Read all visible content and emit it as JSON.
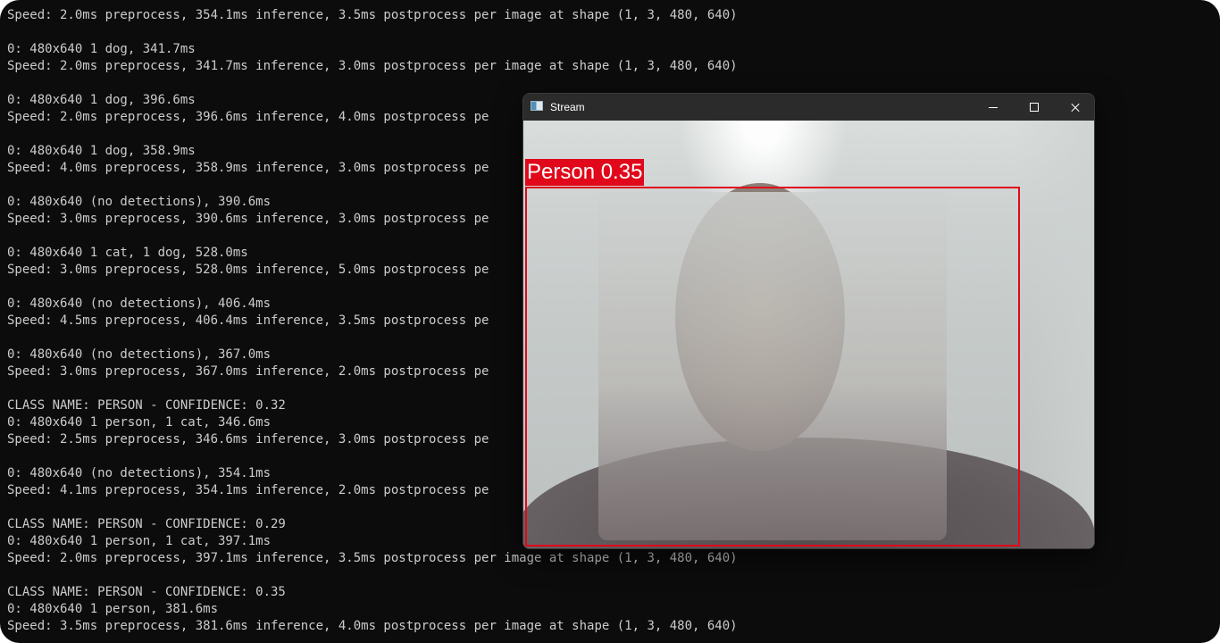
{
  "terminal": {
    "lines": [
      "Speed: 2.0ms preprocess, 354.1ms inference, 3.5ms postprocess per image at shape (1, 3, 480, 640)",
      "",
      "0: 480x640 1 dog, 341.7ms",
      "Speed: 2.0ms preprocess, 341.7ms inference, 3.0ms postprocess per image at shape (1, 3, 480, 640)",
      "",
      "0: 480x640 1 dog, 396.6ms",
      "Speed: 2.0ms preprocess, 396.6ms inference, 4.0ms postprocess pe",
      "",
      "0: 480x640 1 dog, 358.9ms",
      "Speed: 4.0ms preprocess, 358.9ms inference, 3.0ms postprocess pe",
      "",
      "0: 480x640 (no detections), 390.6ms",
      "Speed: 3.0ms preprocess, 390.6ms inference, 3.0ms postprocess pe",
      "",
      "0: 480x640 1 cat, 1 dog, 528.0ms",
      "Speed: 3.0ms preprocess, 528.0ms inference, 5.0ms postprocess pe",
      "",
      "0: 480x640 (no detections), 406.4ms",
      "Speed: 4.5ms preprocess, 406.4ms inference, 3.5ms postprocess pe",
      "",
      "0: 480x640 (no detections), 367.0ms",
      "Speed: 3.0ms preprocess, 367.0ms inference, 2.0ms postprocess pe",
      "",
      "CLASS NAME: PERSON - CONFIDENCE: 0.32",
      "0: 480x640 1 person, 1 cat, 346.6ms",
      "Speed: 2.5ms preprocess, 346.6ms inference, 3.0ms postprocess pe",
      "",
      "0: 480x640 (no detections), 354.1ms",
      "Speed: 4.1ms preprocess, 354.1ms inference, 2.0ms postprocess pe",
      "",
      "CLASS NAME: PERSON - CONFIDENCE: 0.29",
      "0: 480x640 1 person, 1 cat, 397.1ms",
      "Speed: 2.0ms preprocess, 397.1ms inference, 3.5ms postprocess per image at shape (1, 3, 480, 640)",
      "",
      "CLASS NAME: PERSON - CONFIDENCE: 0.35",
      "0: 480x640 1 person, 381.6ms",
      "Speed: 3.5ms preprocess, 381.6ms inference, 4.0ms postprocess per image at shape (1, 3, 480, 640)"
    ]
  },
  "window": {
    "title": "Stream",
    "app_icon": "opencv-window-icon",
    "controls": {
      "minimize_icon": "minimize-icon",
      "maximize_icon": "maximize-icon",
      "close_icon": "close-icon"
    }
  },
  "detection": {
    "label": "Person 0.35",
    "color": "#e0081a"
  },
  "colors": {
    "terminal_bg": "#0c0c0c",
    "terminal_text": "#cccccc",
    "titlebar": "#2b2b2b"
  }
}
